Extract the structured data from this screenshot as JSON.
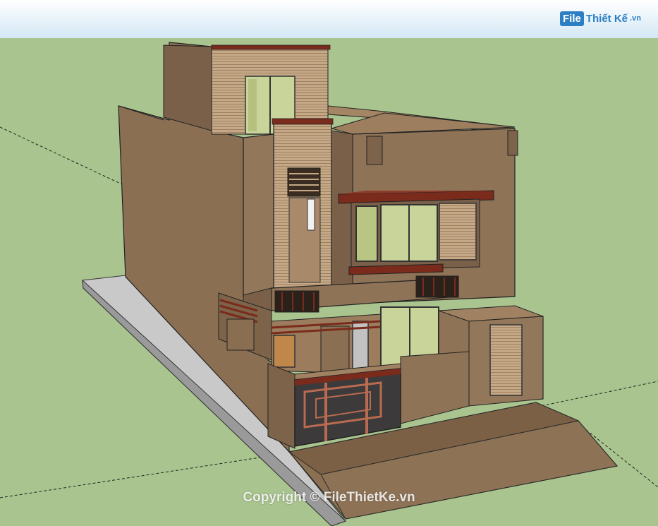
{
  "logo": {
    "badge": "File",
    "name": "Thiết Kế",
    "tld": ".vn"
  },
  "watermark": "Copyright © FileThietKe.vn",
  "colors": {
    "sky": "#d6ecf7",
    "ground": "#a9c48e",
    "wall": "#8b6f52",
    "wall_dark": "#6e5640",
    "slab": "#bdbdbd",
    "trim": "#7a2b1c",
    "glass": "#c9d49a"
  }
}
